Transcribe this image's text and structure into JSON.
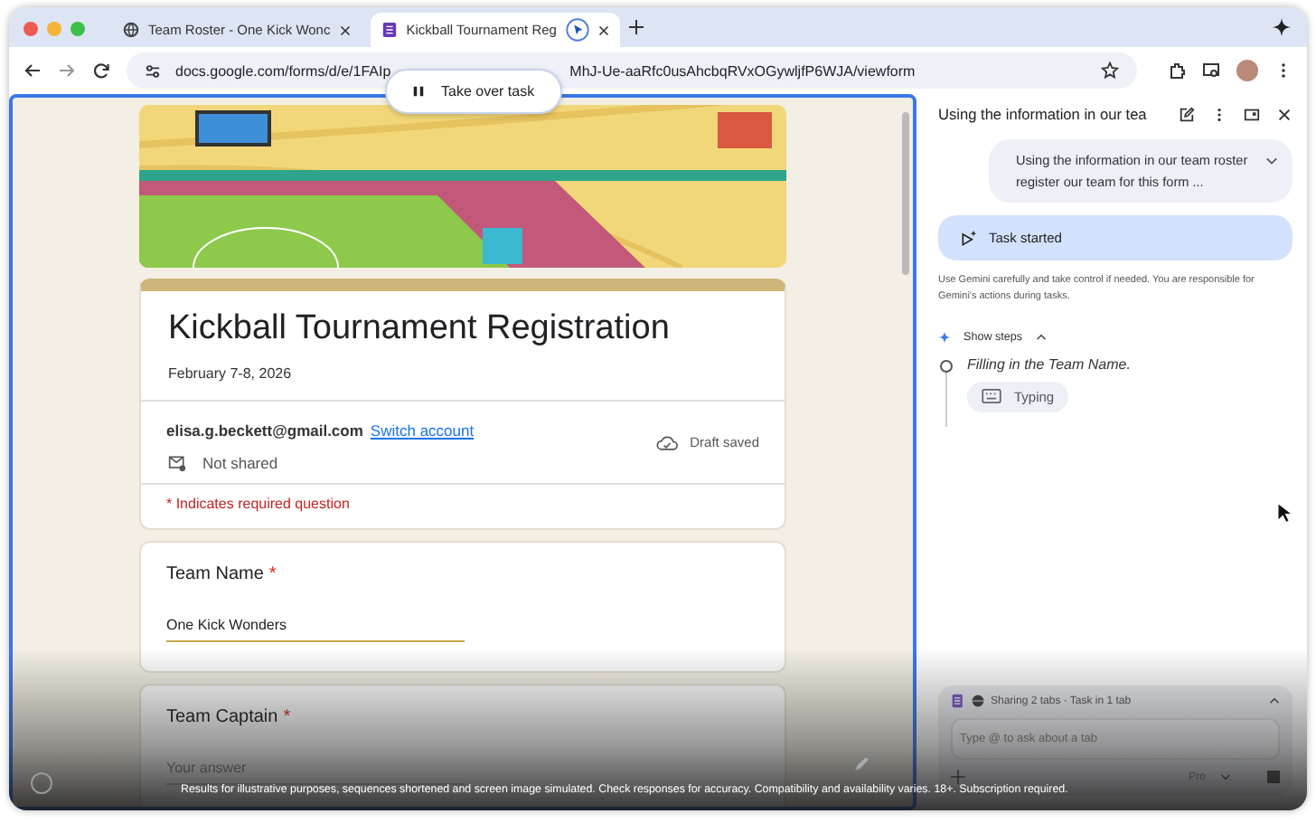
{
  "browser": {
    "tabs": [
      {
        "title": "Team Roster - One Kick Wonc",
        "selected": false,
        "kind": "globe"
      },
      {
        "title": "Kickball Tournament Reg",
        "selected": true,
        "kind": "forms"
      }
    ],
    "url_start": "docs.google.com/forms/d/e/1FAIp",
    "url_end": "MhJ-Ue-aaRfc0usAhcbqRVxOGywljfP6WJA/viewform"
  },
  "agent_control": {
    "label": "Take over task"
  },
  "form": {
    "title": "Kickball Tournament Registration",
    "description": "February 7-8, 2026",
    "account": {
      "email": "elisa.g.beckett@gmail.com",
      "switch_link": "Switch account",
      "sharing": "Not shared",
      "save_status": "Draft saved"
    },
    "required_note": "* Indicates required question",
    "questions": [
      {
        "label": "Team Name",
        "required_mark": "*",
        "value": "One Kick Wonders"
      },
      {
        "label": "Team Captain",
        "required_mark": "*",
        "placeholder": "Your answer"
      }
    ]
  },
  "assistant": {
    "header_title": "Using the information in our tea",
    "prompt": "Using the information in our team roster register our team for this form ...",
    "status": "Task started",
    "notice": "Use Gemini carefully and take control if needed. You are responsible for Gemini's actions during tasks.",
    "steps_toggle": {
      "label": "Show steps",
      "expanded": true
    },
    "steps": [
      {
        "text": "Filling in the Team Name.",
        "substep": "Typing"
      }
    ],
    "composer": {
      "context": "Sharing 2 tabs · Task in 1 tab",
      "placeholder": "Type @ to ask about a tab",
      "model": "Pro"
    }
  },
  "disclaimer": "Results for illustrative purposes, sequences shortened and screen image simulated. Check responses for accuracy. Compatibility and availability varies. 18+. Subscription required."
}
